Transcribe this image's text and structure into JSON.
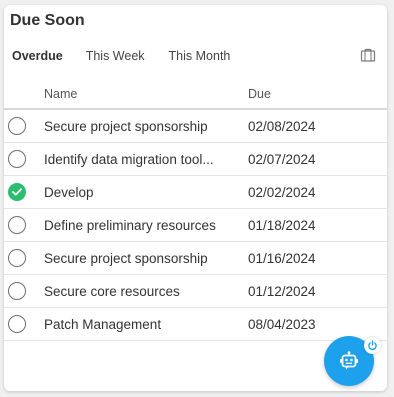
{
  "widget": {
    "title": "Due Soon"
  },
  "tabs": [
    {
      "label": "Overdue",
      "active": true
    },
    {
      "label": "This Week",
      "active": false
    },
    {
      "label": "This Month",
      "active": false
    }
  ],
  "table": {
    "columns": {
      "name": "Name",
      "due": "Due"
    },
    "rows": [
      {
        "name": "Secure project sponsorship",
        "due": "02/08/2024",
        "completed": false
      },
      {
        "name": "Identify data migration tool...",
        "due": "02/07/2024",
        "completed": false
      },
      {
        "name": "Develop",
        "due": "02/02/2024",
        "completed": true
      },
      {
        "name": "Define preliminary resources",
        "due": "01/18/2024",
        "completed": false
      },
      {
        "name": "Secure project sponsorship",
        "due": "01/16/2024",
        "completed": false
      },
      {
        "name": "Secure core resources",
        "due": "01/12/2024",
        "completed": false
      },
      {
        "name": "Patch Management",
        "due": "08/04/2023",
        "completed": false
      }
    ]
  },
  "icons": {
    "toolbar": "briefcase-icon",
    "assistant": "robot-icon",
    "badge": "power-icon"
  },
  "colors": {
    "accent": "#1ea1ec",
    "complete": "#2dbd6e"
  }
}
